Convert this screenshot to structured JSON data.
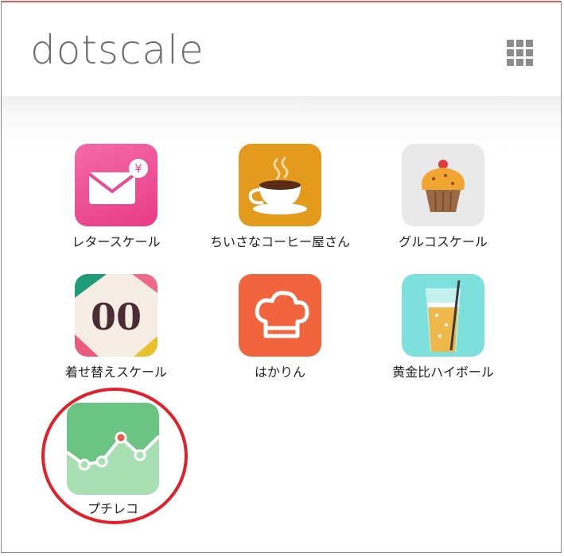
{
  "header": {
    "brand": "dotscale",
    "menu_icon": "grid-icon"
  },
  "apps": [
    {
      "label": "レタースケール",
      "icon": "envelope-yen-icon",
      "color": "#ee4592"
    },
    {
      "label": "ちいさなコーヒー屋さん",
      "icon": "coffee-cup-icon",
      "color": "#e49a1c"
    },
    {
      "label": "グルコスケール",
      "icon": "cupcake-icon",
      "color": "#e9e9e9"
    },
    {
      "label": "着せ替えスケール",
      "icon": "digits-00-icon",
      "digits": "00",
      "color": "#f5ede3"
    },
    {
      "label": "はかりん",
      "icon": "chef-hat-icon",
      "color": "#f2643d"
    },
    {
      "label": "黄金比ハイボール",
      "icon": "highball-glass-icon",
      "color": "#7ee0dc"
    },
    {
      "label": "プチレコ",
      "icon": "line-graph-icon",
      "color": "#6cc483"
    }
  ],
  "highlight": {
    "target": "プチレコ",
    "color": "#e3202a"
  }
}
